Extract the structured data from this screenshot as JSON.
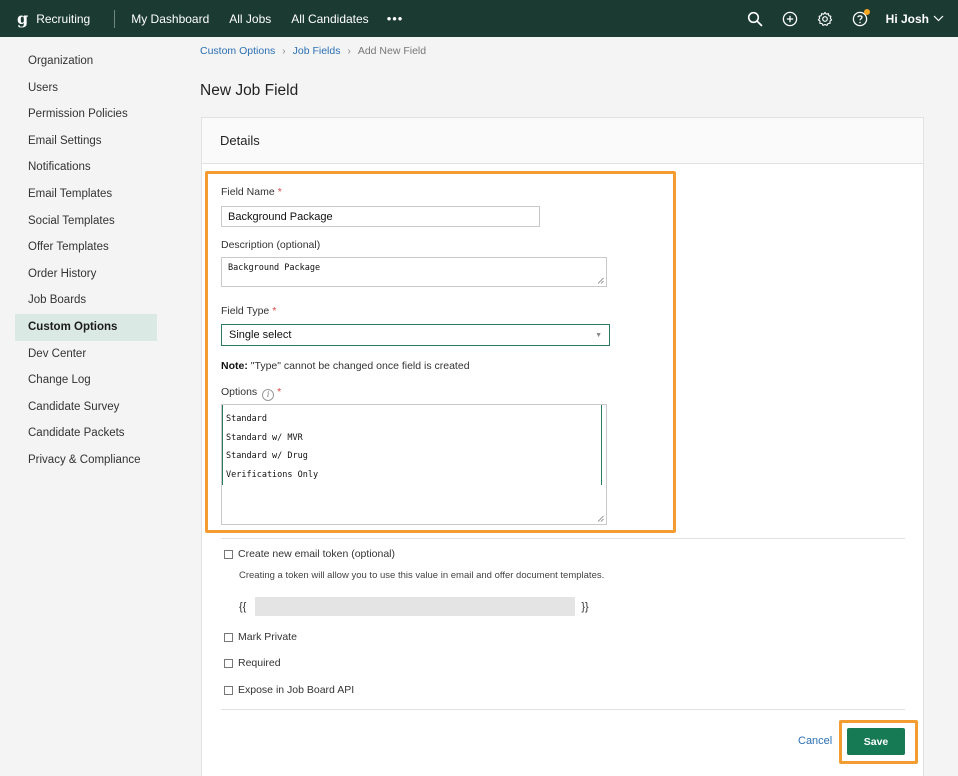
{
  "topnav": {
    "brand_logo": "g",
    "brand_text": "Recruiting",
    "links": [
      "My Dashboard",
      "All Jobs",
      "All Candidates"
    ],
    "more": "•••",
    "user_greeting": "Hi Josh"
  },
  "sidebar": {
    "items": [
      {
        "label": "Organization",
        "active": false
      },
      {
        "label": "Users",
        "active": false
      },
      {
        "label": "Permission Policies",
        "active": false
      },
      {
        "label": "Email Settings",
        "active": false
      },
      {
        "label": "Notifications",
        "active": false
      },
      {
        "label": "Email Templates",
        "active": false
      },
      {
        "label": "Social Templates",
        "active": false
      },
      {
        "label": "Offer Templates",
        "active": false
      },
      {
        "label": "Order History",
        "active": false
      },
      {
        "label": "Job Boards",
        "active": false
      },
      {
        "label": "Custom Options",
        "active": true
      },
      {
        "label": "Dev Center",
        "active": false
      },
      {
        "label": "Change Log",
        "active": false
      },
      {
        "label": "Candidate Survey",
        "active": false
      },
      {
        "label": "Candidate Packets",
        "active": false
      },
      {
        "label": "Privacy & Compliance",
        "active": false
      }
    ]
  },
  "breadcrumb": {
    "items": [
      "Custom Options",
      "Job Fields"
    ],
    "separator": "›",
    "current": "Add New Field"
  },
  "page": {
    "title": "New Job Field",
    "section_title": "Details"
  },
  "form": {
    "field_name": {
      "label": "Field Name",
      "required_mark": "*",
      "value": "Background Package"
    },
    "description": {
      "label": "Description (optional)",
      "value": "Background Package"
    },
    "field_type": {
      "label": "Field Type",
      "required_mark": "*",
      "value": "Single select",
      "caret": "▼"
    },
    "note": {
      "bold": "Note:",
      "text": " \"Type\" cannot be changed once field is created"
    },
    "options": {
      "label": "Options",
      "info_glyph": "i",
      "required_mark": "*",
      "values": [
        "Standard",
        "Standard w/ MVR",
        "Standard w/ Drug",
        "Verifications Only"
      ]
    },
    "email_token": {
      "label": "Create new email token (optional)",
      "help": "Creating a token will allow you to use this value in email and offer document templates.",
      "open_brace": "{{",
      "close_brace": "}}"
    },
    "mark_private": {
      "label": "Mark Private"
    },
    "required": {
      "label": "Required"
    },
    "expose_api": {
      "label": "Expose in Job Board API"
    }
  },
  "actions": {
    "cancel_label": "Cancel",
    "save_label": "Save"
  },
  "colors": {
    "nav_bg": "#1b3a32",
    "accent": "#167a54",
    "highlight": "#f39c32",
    "link": "#2b6fb3"
  },
  "icons": [
    "search-icon",
    "add-circle-icon",
    "gear-icon",
    "help-icon",
    "chevron-down-icon",
    "info-icon"
  ]
}
